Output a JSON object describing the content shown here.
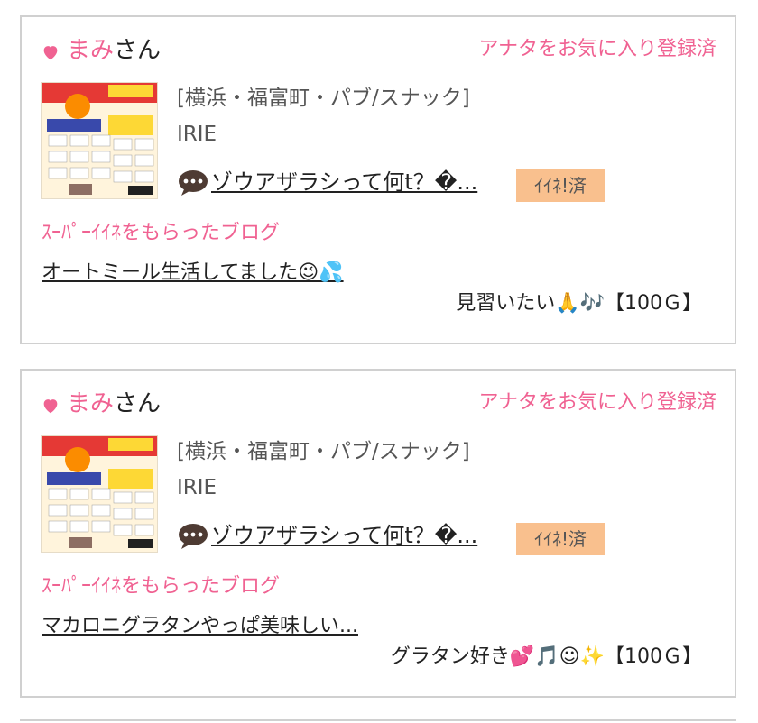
{
  "cards": [
    {
      "user_name": "まみ",
      "user_suffix": "さん",
      "favorite_status": "アナタをお気に入り登録済",
      "thumbnail_icon": "event-flyer-thumbnail",
      "shop_area": "[横浜・福富町・パブ/スナック]",
      "shop_name": "IRIE",
      "post_title": "ゾウアザラシって何t？�...",
      "like_badge": "ｲｲﾈ!済",
      "super_like_label": "ｽｰﾊﾟｰｲｲﾈをもらったブログ",
      "blog_title": "オートミール生活してました😉💦",
      "reply_text": "見習いたい🙏🎶【100Ｇ】"
    },
    {
      "user_name": "まみ",
      "user_suffix": "さん",
      "favorite_status": "アナタをお気に入り登録済",
      "thumbnail_icon": "event-flyer-thumbnail",
      "shop_area": "[横浜・福富町・パブ/スナック]",
      "shop_name": "IRIE",
      "post_title": "ゾウアザラシって何t？�...",
      "like_badge": "ｲｲﾈ!済",
      "super_like_label": "ｽｰﾊﾟｰｲｲﾈをもらったブログ",
      "blog_title": "マカロニグラタンやっぱ美味しい...",
      "reply_text": "グラタン好き💕🎵☺✨【100Ｇ】"
    }
  ],
  "colors": {
    "accent_pink": "#f06292",
    "badge_orange": "#f9c08e",
    "card_border": "#d0d0d0"
  }
}
